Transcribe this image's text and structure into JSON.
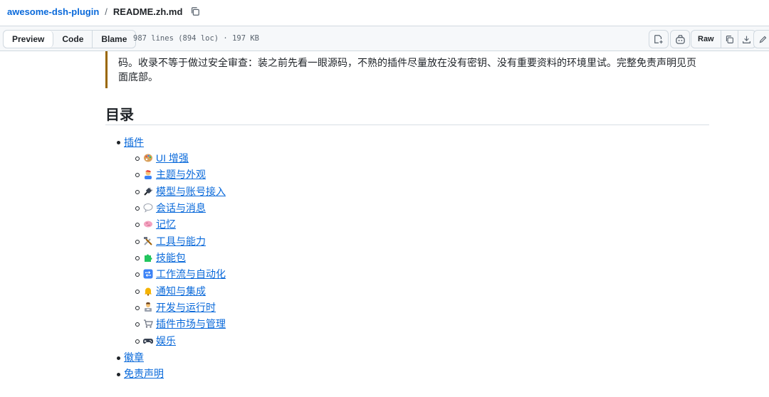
{
  "breadcrumb": {
    "repo": "awesome-dsh-plugin",
    "separator": "/",
    "file": "README.zh.md"
  },
  "toolbar": {
    "tabs": [
      {
        "label": "Preview",
        "active": true
      },
      {
        "label": "Code",
        "active": false
      },
      {
        "label": "Blame",
        "active": false
      }
    ],
    "meta": "987 lines (894 loc) · 197 KB",
    "raw_label": "Raw"
  },
  "content": {
    "quote": "码。收录不等于做过安全审查：装之前先看一眼源码，不熟的插件尽量放在没有密钥、没有重要资料的环境里试。完整免责声明见页面底部。",
    "heading": "目录",
    "toc": {
      "plugins": "插件",
      "sub": [
        {
          "label": "UI 增强",
          "icon": "palette-icon"
        },
        {
          "label": "主题与外观",
          "icon": "artist-icon"
        },
        {
          "label": "模型与账号接入",
          "icon": "plug-icon"
        },
        {
          "label": "会话与消息",
          "icon": "speech-bubble-icon"
        },
        {
          "label": "记忆",
          "icon": "brain-icon"
        },
        {
          "label": "工具与能力",
          "icon": "tools-icon"
        },
        {
          "label": "技能包",
          "icon": "puzzle-icon"
        },
        {
          "label": "工作流与自动化",
          "icon": "repeat-icon"
        },
        {
          "label": "通知与集成",
          "icon": "bell-icon"
        },
        {
          "label": "开发与运行时",
          "icon": "technologist-icon"
        },
        {
          "label": "插件市场与管理",
          "icon": "cart-icon"
        },
        {
          "label": "娱乐",
          "icon": "gamepad-icon"
        }
      ],
      "badges": "徽章",
      "disclaimer": "免责声明"
    }
  },
  "colors": {
    "link": "#0969da",
    "quote_border": "#9a6700",
    "toolbar_bg": "#f6f8fa"
  }
}
